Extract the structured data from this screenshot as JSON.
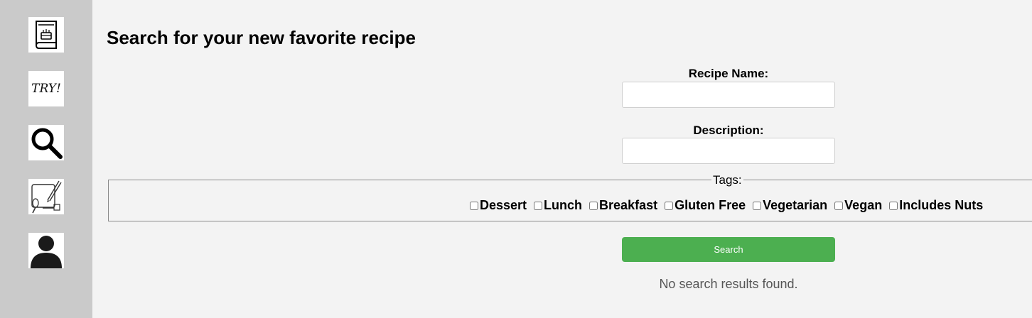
{
  "sidebar": {
    "items": [
      {
        "name": "cookbook",
        "icon": "cookbook-icon"
      },
      {
        "name": "try",
        "icon": "try-text-icon",
        "label": "TRY!"
      },
      {
        "name": "search",
        "icon": "magnifier-icon"
      },
      {
        "name": "create",
        "icon": "write-recipe-icon"
      },
      {
        "name": "profile",
        "icon": "user-icon"
      }
    ]
  },
  "main": {
    "title": "Search for your new favorite recipe",
    "recipe_name": {
      "label": "Recipe Name:",
      "value": "",
      "placeholder": ""
    },
    "description": {
      "label": "Description:",
      "value": "",
      "placeholder": ""
    },
    "tags": {
      "legend": "Tags:",
      "options": [
        {
          "label": "Dessert",
          "checked": false
        },
        {
          "label": "Lunch",
          "checked": false
        },
        {
          "label": "Breakfast",
          "checked": false
        },
        {
          "label": "Gluten Free",
          "checked": false
        },
        {
          "label": "Vegetarian",
          "checked": false
        },
        {
          "label": "Vegan",
          "checked": false
        },
        {
          "label": "Includes Nuts",
          "checked": false
        }
      ]
    },
    "search_button": "Search",
    "no_results": "No search results found."
  },
  "colors": {
    "sidebar_bg": "#cacaca",
    "page_bg": "#f3f3f3",
    "button_green": "#4caf50"
  }
}
